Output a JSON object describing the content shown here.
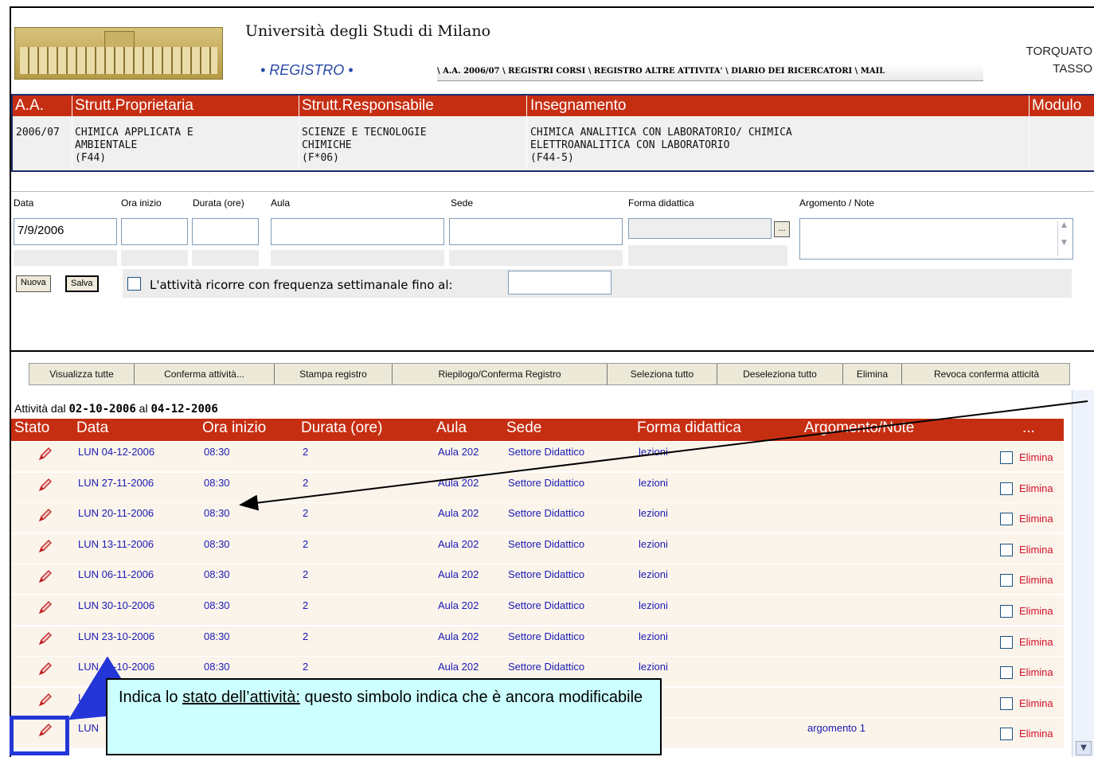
{
  "header": {
    "university": "Università degli Studi di Milano",
    "app_name": "• REGISTRO •",
    "nav": [
      "\\ A.A. 2006/07",
      "\\ REGISTRI CORSI",
      "\\ REGISTRO ALTRE ATTIVITA'",
      "\\ DIARIO DEI RICERCATORI",
      "\\ MAIL"
    ],
    "user_first": "TORQUATO",
    "user_last": "TASSO"
  },
  "course": {
    "headers": [
      "A.A.",
      "Strutt.Proprietaria",
      "Strutt.Responsabile",
      "Insegnamento",
      "Modulo"
    ],
    "aa": "2006/07",
    "proprietaria": "CHIMICA APPLICATA E\nAMBIENTALE\n(F44)",
    "responsabile": "SCIENZE E TECNOLOGIE\nCHIMICHE\n(F*06)",
    "insegnamento": "CHIMICA ANALITICA CON LABORATORIO/ CHIMICA\nELETTROANALITICA CON LABORATORIO\n(F44-5)",
    "modulo": ""
  },
  "form": {
    "labels": {
      "data": "Data",
      "ora_inizio": "Ora inizio",
      "durata": "Durata (ore)",
      "aula": "Aula",
      "sede": "Sede",
      "forma": "Forma didattica",
      "argomento": "Argomento / Note"
    },
    "data_value": "7/9/2006",
    "browse_label": "...",
    "nuova_label": "Nuova",
    "salva_label": "Salva",
    "recurrence_label": "L'attività ricorre con frequenza settimanale fino al:"
  },
  "toolbar": [
    "Visualizza tutte",
    "Conferma attività...",
    "Stampa registro",
    "Riepilogo/Conferma Registro",
    "Seleziona tutto",
    "Deseleziona tutto",
    "Elimina",
    "Revoca conferma atticità"
  ],
  "activities": {
    "range_prefix": "Attività dal",
    "range_from": "02-10-2006",
    "range_mid": "al",
    "range_to": "04-12-2006",
    "headers": [
      "Stato",
      "Data",
      "Ora inizio",
      "Durata (ore)",
      "Aula",
      "Sede",
      "Forma didattica",
      "Argomento/Note",
      "..."
    ],
    "delete_label": "Elimina",
    "rows": [
      {
        "data": "LUN 04-12-2006",
        "ora": "08:30",
        "durata": "2",
        "aula": "Aula 202",
        "sede": "Settore Didattico",
        "forma": "lezioni",
        "argomento": ""
      },
      {
        "data": "LUN 27-11-2006",
        "ora": "08:30",
        "durata": "2",
        "aula": "Aula 202",
        "sede": "Settore Didattico",
        "forma": "lezioni",
        "argomento": ""
      },
      {
        "data": "LUN 20-11-2006",
        "ora": "08:30",
        "durata": "2",
        "aula": "Aula 202",
        "sede": "Settore Didattico",
        "forma": "lezioni",
        "argomento": ""
      },
      {
        "data": "LUN 13-11-2006",
        "ora": "08:30",
        "durata": "2",
        "aula": "Aula 202",
        "sede": "Settore Didattico",
        "forma": "lezioni",
        "argomento": ""
      },
      {
        "data": "LUN 06-11-2006",
        "ora": "08:30",
        "durata": "2",
        "aula": "Aula 202",
        "sede": "Settore Didattico",
        "forma": "lezioni",
        "argomento": ""
      },
      {
        "data": "LUN 30-10-2006",
        "ora": "08:30",
        "durata": "2",
        "aula": "Aula 202",
        "sede": "Settore Didattico",
        "forma": "lezioni",
        "argomento": ""
      },
      {
        "data": "LUN 23-10-2006",
        "ora": "08:30",
        "durata": "2",
        "aula": "Aula 202",
        "sede": "Settore Didattico",
        "forma": "lezioni",
        "argomento": ""
      },
      {
        "data": "LUN 16-10-2006",
        "ora": "08:30",
        "durata": "2",
        "aula": "Aula 202",
        "sede": "Settore Didattico",
        "forma": "lezioni",
        "argomento": ""
      },
      {
        "data": "LUN",
        "ora": "",
        "durata": "",
        "aula": "",
        "sede": "",
        "forma": "ni",
        "argomento": ""
      },
      {
        "data": "LUN",
        "ora": "",
        "durata": "",
        "aula": "",
        "sede": "",
        "forma": "ni",
        "argomento": "argomento 1"
      }
    ]
  },
  "annotation": {
    "text_before": "Indica lo ",
    "text_underlined": "stato dell’attività:",
    "text_after": " questo simbolo indica che è ancora modificabile"
  },
  "colors": {
    "header_red": "#c62e12",
    "link_blue": "#1a1ab5",
    "delete_red": "#d0102a",
    "callout_bg": "#ccffff",
    "highlight_blue": "#2436d8"
  }
}
